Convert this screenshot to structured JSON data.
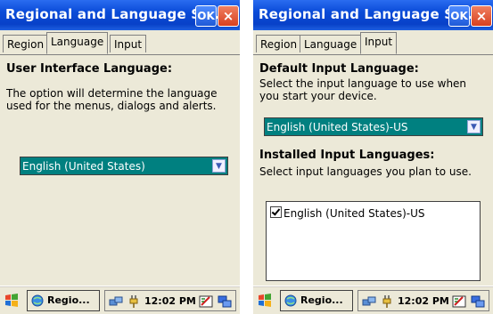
{
  "window_title": "Regional and Language Se...",
  "ok_label": "OK",
  "close_label": "×",
  "tabs": {
    "region": "Region",
    "language": "Language",
    "input": "Input"
  },
  "left": {
    "heading": "User Interface Language:",
    "description": "The option will determine the language used for the menus, dialogs and alerts.",
    "language_select": "English (United States)"
  },
  "right": {
    "default_heading": "Default Input Language:",
    "default_description": "Select the input language to use when you start your device.",
    "input_select": "English (United States)-US",
    "installed_heading": "Installed Input Languages:",
    "installed_description": "Select input languages you plan to use.",
    "installed_items": [
      "English (United States)-US"
    ]
  },
  "taskbar": {
    "task_label": "Regio...",
    "clock": "12:02 PM"
  },
  "icons": {
    "start": "windows-flag-icon",
    "task": "regional-settings-icon",
    "network": "network-icon",
    "power": "power-plug-icon",
    "input_panel": "input-panel-icon",
    "desktop": "desktop-switch-icon"
  },
  "colors": {
    "titlebar": "#0a4bd8",
    "selection": "#008080",
    "face": "#ece9d8",
    "close": "#d84020"
  }
}
